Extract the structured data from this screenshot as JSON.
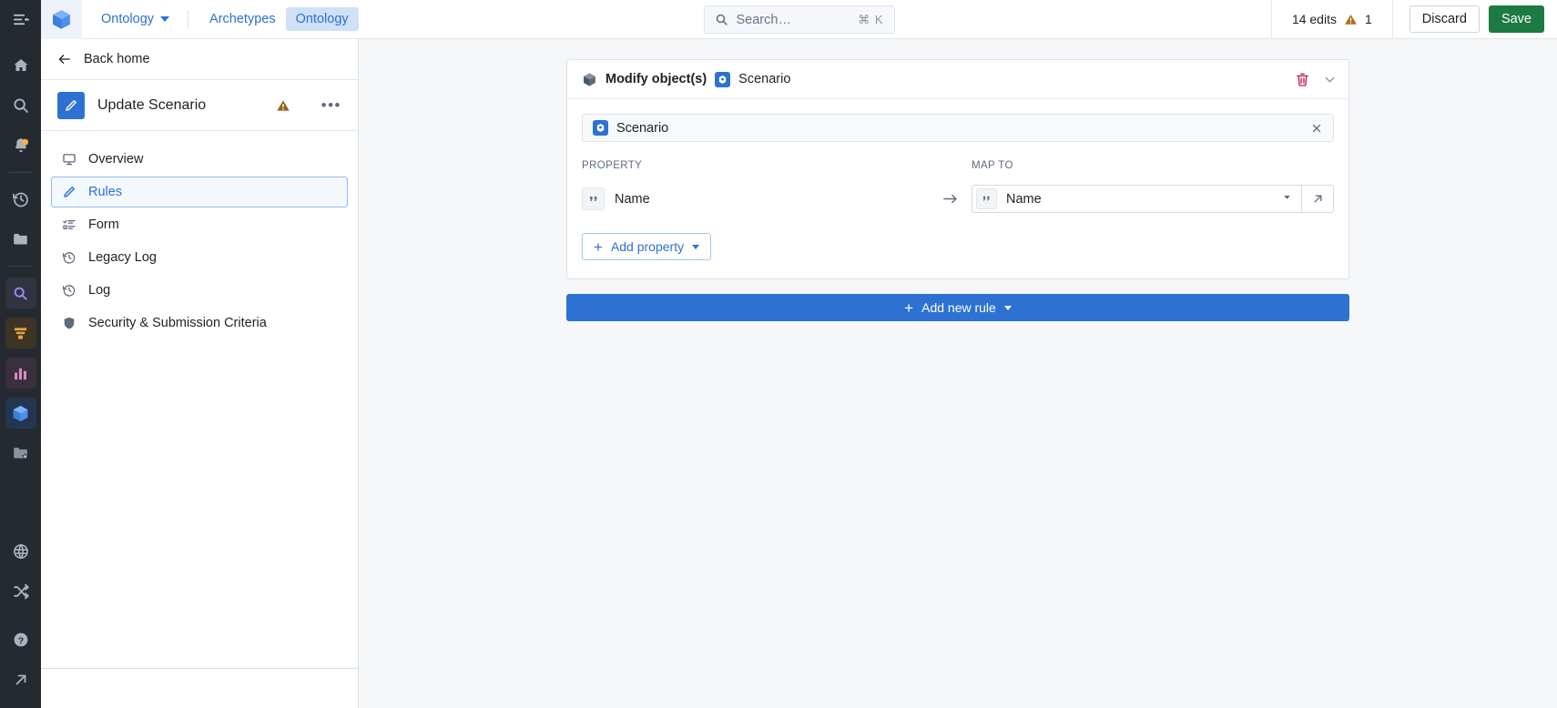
{
  "topbar": {
    "menu_icon": "collapse-menu-icon",
    "logo_icon": "cube-logo-icon",
    "breadcrumb": {
      "label": "Ontology",
      "caret": "chevron-down-icon"
    },
    "tabs": [
      {
        "label": "Archetypes",
        "active": false
      },
      {
        "label": "Ontology",
        "active": true
      }
    ],
    "search": {
      "placeholder": "Search…",
      "shortcut": "⌘ K",
      "icon": "search-icon"
    },
    "edits": {
      "count_label": "14 edits",
      "warning_icon": "warning-triangle-icon",
      "warning_count": "1"
    },
    "discard_label": "Discard",
    "save_label": "Save"
  },
  "rail": {
    "icons": [
      "home-icon",
      "search-icon",
      "notifications-bell-icon",
      "history-icon",
      "folder-icon",
      "object-explorer-icon",
      "filter-funnel-icon",
      "bar-chart-icon",
      "ontology-cube-icon",
      "starred-folder-icon",
      "globe-icon",
      "shuffle-icon",
      "help-circle-icon",
      "external-link-icon"
    ]
  },
  "sidebar": {
    "back_label": "Back home",
    "back_icon": "arrow-left-icon",
    "title": "Update Scenario",
    "title_icon": "pencil-icon",
    "warning_icon": "warning-triangle-icon",
    "more_icon": "more-horizontal-icon",
    "items": [
      {
        "label": "Overview",
        "icon": "monitor-icon",
        "active": false
      },
      {
        "label": "Rules",
        "icon": "pencil-icon",
        "active": true
      },
      {
        "label": "Form",
        "icon": "form-list-icon",
        "active": false
      },
      {
        "label": "Legacy Log",
        "icon": "history-icon",
        "active": false
      },
      {
        "label": "Log",
        "icon": "history-icon",
        "active": false
      },
      {
        "label": "Security & Submission Criteria",
        "icon": "shield-icon",
        "active": false
      }
    ]
  },
  "main": {
    "rule_card": {
      "header_icon": "cube-outline-icon",
      "header_title": "Modify object(s)",
      "object_badge_icon": "object-type-icon",
      "object_label": "Scenario",
      "delete_icon": "trash-icon",
      "collapse_icon": "chevron-down-icon",
      "target": {
        "badge_icon": "object-type-icon",
        "value": "Scenario",
        "clear_icon": "close-x-icon"
      },
      "columns": {
        "property_label": "PROPERTY",
        "map_to_label": "MAP TO"
      },
      "arrow_icon": "arrow-right-icon",
      "mappings": [
        {
          "property": {
            "type_icon": "string-quote-icon",
            "name": "Name"
          },
          "map_to": {
            "type_icon": "string-quote-icon",
            "value": "Name",
            "caret_icon": "chevron-down-icon",
            "expand_icon": "arrow-up-right-icon"
          }
        }
      ],
      "add_property_label": "Add property",
      "add_property_icon": "plus-icon"
    },
    "add_rule_label": "Add new rule",
    "add_rule_icon": "plus-icon"
  },
  "colors": {
    "brand_blue": "#2d72d2",
    "save_green": "#1c7a43",
    "warning_orange": "#b06b12",
    "danger_red": "#c22762",
    "rail_bg": "#252a31",
    "canvas_bg": "#f5f7f9"
  }
}
